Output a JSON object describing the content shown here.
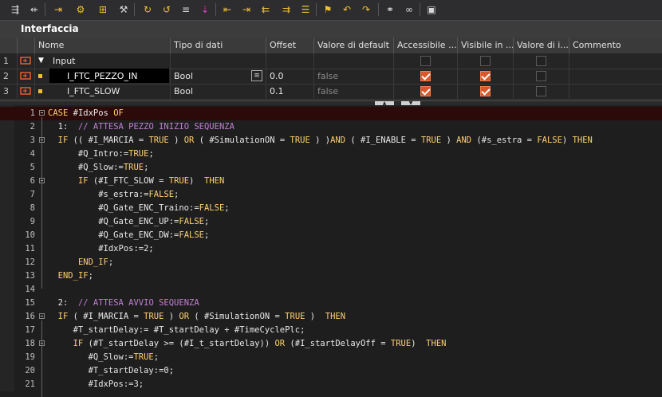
{
  "toolbar": {
    "icons": [
      "insert-network-icon",
      "remove-network-icon",
      "jump-icon",
      "monitor-icon",
      "add-variable-icon",
      "settings-icon",
      "expand-icon",
      "collapse-icon",
      "list-icon",
      "bookmark-icon",
      "indent-left-icon",
      "indent-right-icon",
      "outdent-icon",
      "indent-icon",
      "align-icon",
      "flag-icon",
      "return-icon",
      "refresh-icon",
      "compare-icon",
      "glasses-icon",
      "block-icon"
    ]
  },
  "interface": {
    "title": "Interfaccia"
  },
  "table": {
    "headers": [
      "Nome",
      "Tipo di dati",
      "Offset",
      "Valore di default",
      "Accessibile ...",
      "Visibile in ...",
      "Valore di i...",
      "Commento"
    ],
    "rows": [
      {
        "num": "1",
        "name": "Input",
        "type": "",
        "offset": "",
        "default": "",
        "accessible": false,
        "visible": false,
        "setpoint": false
      },
      {
        "num": "2",
        "name": "I_FTC_PEZZO_IN",
        "type": "Bool",
        "offset": "0.0",
        "default": "false",
        "accessible": true,
        "visible": true,
        "setpoint": false
      },
      {
        "num": "3",
        "name": "I_FTC_SLOW",
        "type": "Bool",
        "offset": "0.1",
        "default": "false",
        "accessible": true,
        "visible": true,
        "setpoint": false
      }
    ]
  },
  "code": {
    "lines": [
      {
        "n": "1",
        "text": "CASE #IdxPos OF"
      },
      {
        "n": "2",
        "text": "  1:  // ATTESA PEZZO INIZIO SEQUENZA"
      },
      {
        "n": "3",
        "text": "  IF (( #I_MARCIA = TRUE ) OR ( #SimulationON = TRUE ) )AND ( #I_ENABLE = TRUE ) AND (#s_estra = FALSE) THEN"
      },
      {
        "n": "4",
        "text": "      #Q_Intro:=TRUE;"
      },
      {
        "n": "5",
        "text": "      #Q_Slow:=TRUE;"
      },
      {
        "n": "6",
        "text": "      IF (#I_FTC_SLOW = TRUE)  THEN"
      },
      {
        "n": "7",
        "text": "          #s_estra:=FALSE;"
      },
      {
        "n": "8",
        "text": "          #Q_Gate_ENC_Traino:=FALSE;"
      },
      {
        "n": "9",
        "text": "          #Q_Gate_ENC_UP:=FALSE;"
      },
      {
        "n": "10",
        "text": "          #Q_Gate_ENC_DW:=FALSE;"
      },
      {
        "n": "11",
        "text": "          #IdxPos:=2;"
      },
      {
        "n": "12",
        "text": "      END_IF;"
      },
      {
        "n": "13",
        "text": "  END_IF;"
      },
      {
        "n": "14",
        "text": ""
      },
      {
        "n": "15",
        "text": "  2:  // ATTESA AVVIO SEQUENZA"
      },
      {
        "n": "16",
        "text": "  IF ( #I_MARCIA = TRUE ) OR ( #SimulationON = TRUE )  THEN"
      },
      {
        "n": "17",
        "text": "     #T_startDelay:= #T_startDelay + #TimeCyclePlc;"
      },
      {
        "n": "18",
        "text": "     IF (#T_startDelay >= (#I_t_startDelay)) OR (#I_startDelayOff = TRUE)  THEN"
      },
      {
        "n": "19",
        "text": "        #Q_Slow:=TRUE;"
      },
      {
        "n": "20",
        "text": "        #T_startDelay:=0;"
      },
      {
        "n": "21",
        "text": "        #IdxPos:=3;"
      }
    ]
  }
}
